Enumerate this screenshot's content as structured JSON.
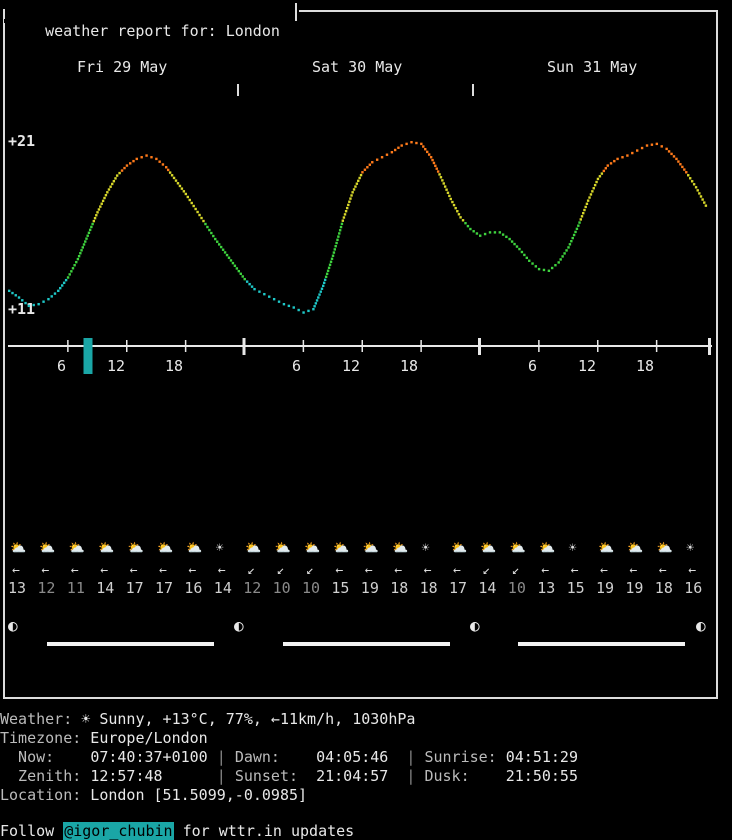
{
  "report": {
    "title": " weather report for: London "
  },
  "days": [
    "Fri 29 May",
    "Sat 30 May",
    "Sun 31 May"
  ],
  "hour_ticks": [
    "6",
    "12",
    "18",
    "6",
    "12",
    "18",
    "6",
    "12",
    "18"
  ],
  "chart_data": {
    "type": "line",
    "title": "",
    "xlabel": "",
    "ylabel": "",
    "y_tick_labels": [
      "+21",
      "+11"
    ],
    "ylim": [
      10,
      22
    ],
    "x_unit": "hours since Fri 29 May 00:00",
    "current_hour_marker": 8,
    "series": [
      {
        "x": [
          0,
          1,
          2,
          3,
          4,
          5,
          6,
          7,
          8,
          9,
          10,
          11,
          12,
          13,
          14,
          15,
          16,
          17,
          18,
          19,
          20,
          21,
          22,
          23,
          24,
          25,
          26,
          27,
          28,
          29,
          30,
          31,
          32,
          33,
          34,
          35,
          36,
          37,
          38,
          39,
          40,
          41,
          42,
          43,
          44,
          45,
          46,
          47,
          48,
          49,
          50,
          51,
          52,
          53,
          54,
          55,
          56,
          57,
          58,
          59,
          60,
          61,
          62,
          63,
          64,
          65,
          66,
          67,
          68,
          69,
          70,
          71
        ],
        "y": [
          12.1,
          11.7,
          11.2,
          11.3,
          11.6,
          12.1,
          12.9,
          14.0,
          15.4,
          16.8,
          18.0,
          19.0,
          19.6,
          20.0,
          20.2,
          20.0,
          19.5,
          18.7,
          17.9,
          17.0,
          16.1,
          15.2,
          14.4,
          13.6,
          12.8,
          12.2,
          11.9,
          11.6,
          11.3,
          11.1,
          10.8,
          11.0,
          12.4,
          14.2,
          16.3,
          18.0,
          19.2,
          19.8,
          20.1,
          20.4,
          20.8,
          21.0,
          20.9,
          20.1,
          18.9,
          17.6,
          16.5,
          15.8,
          15.4,
          15.6,
          15.6,
          15.2,
          14.6,
          13.9,
          13.4,
          13.3,
          13.8,
          14.7,
          16.0,
          17.5,
          18.8,
          19.6,
          20.0,
          20.2,
          20.5,
          20.8,
          20.9,
          20.6,
          20.0,
          19.2,
          18.3,
          17.2
        ],
        "color_scale": "temperature"
      }
    ]
  },
  "forecast": {
    "icons": [
      "cloud-sun",
      "cloud-sun",
      "cloud-sun",
      "cloud-sun",
      "cloud-sun",
      "cloud-sun",
      "cloud-sun",
      "sun",
      "cloud-sun",
      "cloud-sun",
      "cloud-sun",
      "cloud-sun",
      "cloud-sun",
      "cloud-sun",
      "sun",
      "cloud-sun",
      "cloud-sun",
      "cloud-sun",
      "cloud-sun",
      "sun",
      "cloud-sun",
      "cloud-sun",
      "cloud-sun",
      "sun"
    ],
    "winds": [
      "←",
      "←",
      "←",
      "←",
      "←",
      "←",
      "←",
      "←",
      "↙",
      "↙",
      "↙",
      "←",
      "←",
      "←",
      "←",
      "←",
      "↙",
      "↙",
      "←",
      "←",
      "←",
      "←",
      "←",
      "←"
    ],
    "temps": [
      "13",
      "12",
      "11",
      "14",
      "17",
      "17",
      "16",
      "14",
      "12",
      "10",
      "10",
      "15",
      "19",
      "18",
      "18",
      "17",
      "14",
      "10",
      "13",
      "15",
      "19",
      "19",
      "18",
      "16"
    ],
    "dim_idx": [
      1,
      2,
      8,
      9,
      10,
      17
    ]
  },
  "moon": {
    "phases": [
      "◐",
      "◐",
      "◐",
      "◐"
    ]
  },
  "info": {
    "weather_label": "Weather:",
    "weather_value": " ☀ Sunny, +13°C, 77%, ←11km/h, 1030hPa",
    "timezone_label": "Timezone:",
    "timezone_value": " Europe/London",
    "now_label": "  Now:    ",
    "now_value": "07:40:37+0100",
    "dawn_label": "Dawn:    ",
    "dawn_value": "04:05:46",
    "sunrise_label": "Sunrise:",
    "sunrise_value": " 04:51:29",
    "zenith_label": "  Zenith: ",
    "zenith_value": "12:57:48     ",
    "sunset_label": "Sunset:  ",
    "sunset_value": "21:04:57",
    "dusk_label": "Dusk:    ",
    "dusk_value": "21:50:55",
    "location_label": "Location:",
    "location_value": " London [51.5099,-0.0985]",
    "follow_prefix": "Follow ",
    "follow_handle": "@igor_chubin",
    "follow_suffix": " for wttr.in updates"
  },
  "colors": {
    "cold": "#1ec8c8",
    "cool": "#3ed23e",
    "mild": "#d7d72a",
    "warm": "#ff7a1a",
    "accent": "#1aa6a6"
  }
}
